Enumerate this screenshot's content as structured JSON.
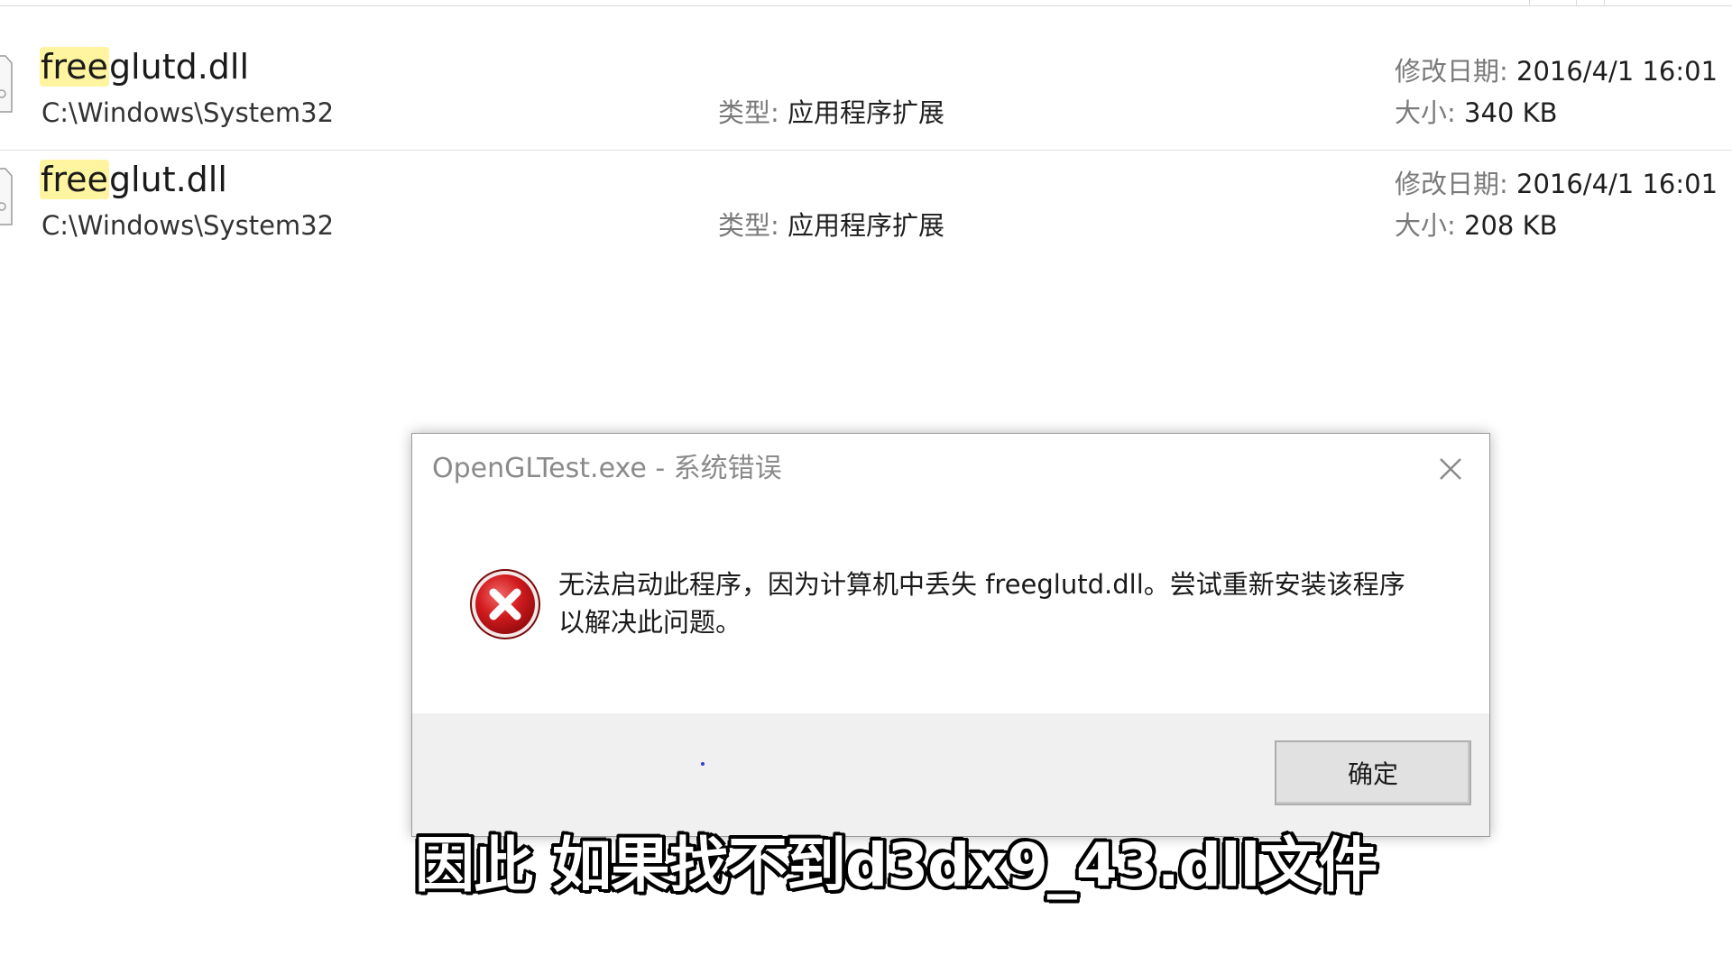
{
  "results": [
    {
      "name_match": "free",
      "name_rest": "glutd.dll",
      "path": "C:\\Windows\\System32",
      "type_label": "类型:",
      "type_value": "应用程序扩展",
      "date_label": "修改日期:",
      "date_value": "2016/4/1 16:01",
      "size_label": "大小:",
      "size_value": "340 KB",
      "icon": "file-icon"
    },
    {
      "name_match": "free",
      "name_rest": "glut.dll",
      "path": "C:\\Windows\\System32",
      "type_label": "类型:",
      "type_value": "应用程序扩展",
      "date_label": "修改日期:",
      "date_value": "2016/4/1 16:01",
      "size_label": "大小:",
      "size_value": "208 KB",
      "icon": "file-icon"
    }
  ],
  "dialog": {
    "title": "OpenGLTest.exe - 系统错误",
    "message": "无法启动此程序，因为计算机中丢失 freeglutd.dll。尝试重新安装该程序以解决此问题。",
    "ok_label": "确定",
    "icon": "error-icon",
    "close_icon": "close-icon"
  },
  "subtitle": "因此 如果找不到d3dx9_43.dll文件",
  "colors": {
    "highlight": "#fff4a0",
    "error_red": "#c0161a",
    "dialog_footer": "#f0f0f0",
    "subtitle_text": "#ffffff",
    "subtitle_outline": "#000000"
  }
}
